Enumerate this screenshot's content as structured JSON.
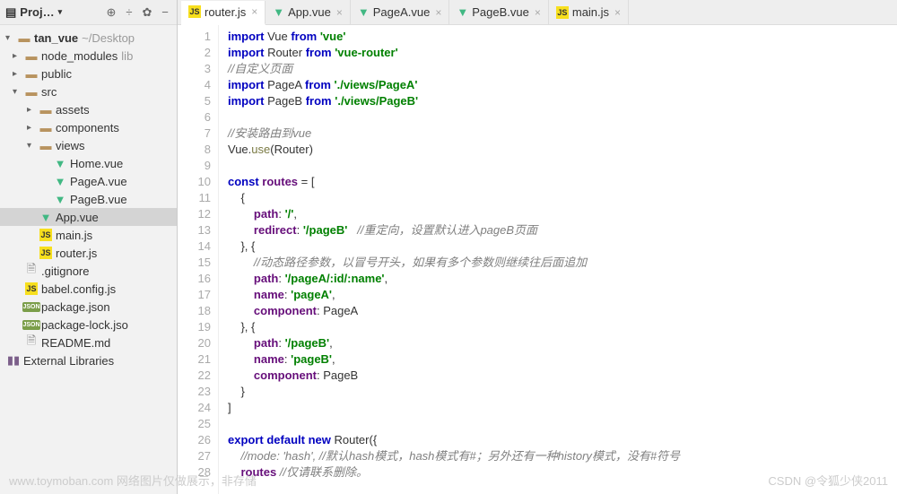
{
  "sidebar": {
    "title": "Proj…",
    "project_root": "tan_vue",
    "project_path": "~/Desktop",
    "items": [
      {
        "label": "node_modules",
        "hint": "lib",
        "type": "folder",
        "indent": 1,
        "arrow": "▸"
      },
      {
        "label": "public",
        "type": "folder",
        "indent": 1,
        "arrow": "▸"
      },
      {
        "label": "src",
        "type": "folder",
        "indent": 1,
        "arrow": "▾"
      },
      {
        "label": "assets",
        "type": "folder",
        "indent": 2,
        "arrow": "▸"
      },
      {
        "label": "components",
        "type": "folder",
        "indent": 2,
        "arrow": "▸"
      },
      {
        "label": "views",
        "type": "folder",
        "indent": 2,
        "arrow": "▾"
      },
      {
        "label": "Home.vue",
        "type": "vue",
        "indent": 3
      },
      {
        "label": "PageA.vue",
        "type": "vue",
        "indent": 3
      },
      {
        "label": "PageB.vue",
        "type": "vue",
        "indent": 3
      },
      {
        "label": "App.vue",
        "type": "vue",
        "indent": 2,
        "selected": true
      },
      {
        "label": "main.js",
        "type": "js",
        "indent": 2
      },
      {
        "label": "router.js",
        "type": "js",
        "indent": 2
      },
      {
        "label": ".gitignore",
        "type": "file",
        "indent": 1
      },
      {
        "label": "babel.config.js",
        "type": "js",
        "indent": 1
      },
      {
        "label": "package.json",
        "type": "json",
        "indent": 1
      },
      {
        "label": "package-lock.jso",
        "type": "json",
        "indent": 1
      },
      {
        "label": "README.md",
        "type": "file",
        "indent": 1
      }
    ],
    "external_lib": "External Libraries"
  },
  "tabs": [
    {
      "label": "router.js",
      "type": "js",
      "active": true
    },
    {
      "label": "App.vue",
      "type": "vue"
    },
    {
      "label": "PageA.vue",
      "type": "vue"
    },
    {
      "label": "PageB.vue",
      "type": "vue"
    },
    {
      "label": "main.js",
      "type": "js"
    }
  ],
  "code": {
    "lines": [
      {
        "n": 1,
        "tokens": [
          [
            "kw",
            "import"
          ],
          [
            "ident",
            " Vue "
          ],
          [
            "kw",
            "from"
          ],
          [
            "ident",
            " "
          ],
          [
            "str",
            "'vue'"
          ]
        ]
      },
      {
        "n": 2,
        "tokens": [
          [
            "kw",
            "import"
          ],
          [
            "ident",
            " Router "
          ],
          [
            "kw",
            "from"
          ],
          [
            "ident",
            " "
          ],
          [
            "str",
            "'vue-router'"
          ]
        ]
      },
      {
        "n": 3,
        "tokens": [
          [
            "com",
            "//自定义页面"
          ]
        ]
      },
      {
        "n": 4,
        "tokens": [
          [
            "kw",
            "import"
          ],
          [
            "ident",
            " PageA "
          ],
          [
            "kw",
            "from"
          ],
          [
            "ident",
            " "
          ],
          [
            "str",
            "'./views/PageA'"
          ]
        ]
      },
      {
        "n": 5,
        "tokens": [
          [
            "kw",
            "import"
          ],
          [
            "ident",
            " PageB "
          ],
          [
            "kw",
            "from"
          ],
          [
            "ident",
            " "
          ],
          [
            "str",
            "'./views/PageB'"
          ]
        ]
      },
      {
        "n": 6,
        "tokens": []
      },
      {
        "n": 7,
        "tokens": [
          [
            "com",
            "//安装路由到vue"
          ]
        ]
      },
      {
        "n": 8,
        "tokens": [
          [
            "ident",
            "Vue."
          ],
          [
            "fn",
            "use"
          ],
          [
            "ident",
            "(Router)"
          ]
        ]
      },
      {
        "n": 9,
        "tokens": []
      },
      {
        "n": 10,
        "tokens": [
          [
            "kw",
            "const"
          ],
          [
            "ident",
            " "
          ],
          [
            "prop",
            "routes"
          ],
          [
            "ident",
            " = ["
          ]
        ]
      },
      {
        "n": 11,
        "tokens": [
          [
            "ident",
            "    {"
          ]
        ]
      },
      {
        "n": 12,
        "tokens": [
          [
            "ident",
            "        "
          ],
          [
            "prop",
            "path"
          ],
          [
            "ident",
            ": "
          ],
          [
            "str",
            "'/'"
          ],
          [
            "ident",
            ","
          ]
        ]
      },
      {
        "n": 13,
        "tokens": [
          [
            "ident",
            "        "
          ],
          [
            "prop",
            "redirect"
          ],
          [
            "ident",
            ": "
          ],
          [
            "str",
            "'/pageB'"
          ],
          [
            "ident",
            "   "
          ],
          [
            "com",
            "//重定向，设置默认进入pageB页面"
          ]
        ]
      },
      {
        "n": 14,
        "tokens": [
          [
            "ident",
            "    }, {"
          ]
        ]
      },
      {
        "n": 15,
        "tokens": [
          [
            "ident",
            "        "
          ],
          [
            "com",
            "//动态路径参数，以冒号开头，如果有多个参数则继续往后面追加"
          ]
        ]
      },
      {
        "n": 16,
        "tokens": [
          [
            "ident",
            "        "
          ],
          [
            "prop",
            "path"
          ],
          [
            "ident",
            ": "
          ],
          [
            "str",
            "'/pageA/:id/:name'"
          ],
          [
            "ident",
            ","
          ]
        ]
      },
      {
        "n": 17,
        "tokens": [
          [
            "ident",
            "        "
          ],
          [
            "prop",
            "name"
          ],
          [
            "ident",
            ": "
          ],
          [
            "str",
            "'pageA'"
          ],
          [
            "ident",
            ","
          ]
        ]
      },
      {
        "n": 18,
        "tokens": [
          [
            "ident",
            "        "
          ],
          [
            "prop",
            "component"
          ],
          [
            "ident",
            ": PageA"
          ]
        ]
      },
      {
        "n": 19,
        "tokens": [
          [
            "ident",
            "    }, {"
          ]
        ]
      },
      {
        "n": 20,
        "tokens": [
          [
            "ident",
            "        "
          ],
          [
            "prop",
            "path"
          ],
          [
            "ident",
            ": "
          ],
          [
            "str",
            "'/pageB'"
          ],
          [
            "ident",
            ","
          ]
        ]
      },
      {
        "n": 21,
        "tokens": [
          [
            "ident",
            "        "
          ],
          [
            "prop",
            "name"
          ],
          [
            "ident",
            ": "
          ],
          [
            "str",
            "'pageB'"
          ],
          [
            "ident",
            ","
          ]
        ]
      },
      {
        "n": 22,
        "tokens": [
          [
            "ident",
            "        "
          ],
          [
            "prop",
            "component"
          ],
          [
            "ident",
            ": PageB"
          ]
        ]
      },
      {
        "n": 23,
        "tokens": [
          [
            "ident",
            "    }"
          ]
        ]
      },
      {
        "n": 24,
        "tokens": [
          [
            "ident",
            "]"
          ]
        ]
      },
      {
        "n": 25,
        "tokens": []
      },
      {
        "n": 26,
        "tokens": [
          [
            "kw",
            "export default new"
          ],
          [
            "ident",
            " Router({"
          ]
        ]
      },
      {
        "n": 27,
        "tokens": [
          [
            "ident",
            "    "
          ],
          [
            "com",
            "//mode: 'hash', //默认hash模式，hash模式有#；另外还有一种history模式，没有#符号"
          ]
        ]
      },
      {
        "n": 28,
        "tokens": [
          [
            "ident",
            "    "
          ],
          [
            "prop",
            "routes"
          ],
          [
            "com",
            " //仅请联系删除。"
          ]
        ]
      }
    ]
  },
  "watermark_right": "CSDN @令狐少侠2011",
  "watermark_left": "www.toymoban.com 网络图片仅做展示，非存储"
}
